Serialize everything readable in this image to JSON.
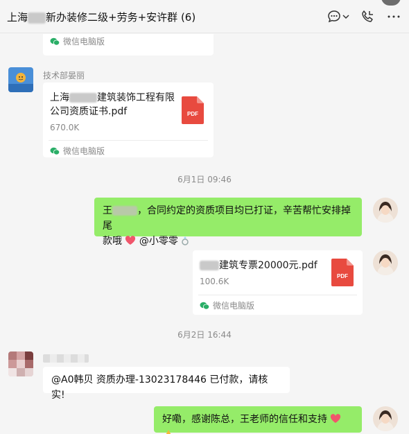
{
  "header": {
    "title_prefix": "上海",
    "title_suffix": "新办装修二级+劳务+安许群",
    "member_count": "(6)",
    "icons": [
      "chat-more-icon",
      "chevron-down-icon",
      "phone-icon",
      "more-icon"
    ]
  },
  "messages": {
    "top_file": {
      "source": "微信电脑版"
    },
    "file1": {
      "sender": "技术部晏丽",
      "name_line1_prefix": "上海",
      "name_line1_suffix": "建筑装饰工程有限",
      "name_line2": "公司资质证书.pdf",
      "size": "670.0K",
      "source": "微信电脑版",
      "badge": "PDF"
    },
    "time1": "6月1日 09:46",
    "msg1": {
      "prefix": "王",
      "line1": "，合同约定的资质项目均已打证，辛苦帮忙安排掉尾",
      "line2": "款哦",
      "mention": "@小零零"
    },
    "file2": {
      "name_suffix": "建筑专票20000元.pdf",
      "size": "100.6K",
      "source": "微信电脑版",
      "badge": "PDF"
    },
    "time2": "6月2日 16:44",
    "msg2": {
      "text": "@A0韩贝 资质办理-13023178446 已付款，请核实!"
    },
    "msg3": {
      "text": "好嘞，感谢陈总，王老师的信任和支持"
    }
  },
  "colors": {
    "green_bubble": "#95ec69",
    "pdf_red": "#e84a3f",
    "wechat_green": "#2aae67"
  }
}
